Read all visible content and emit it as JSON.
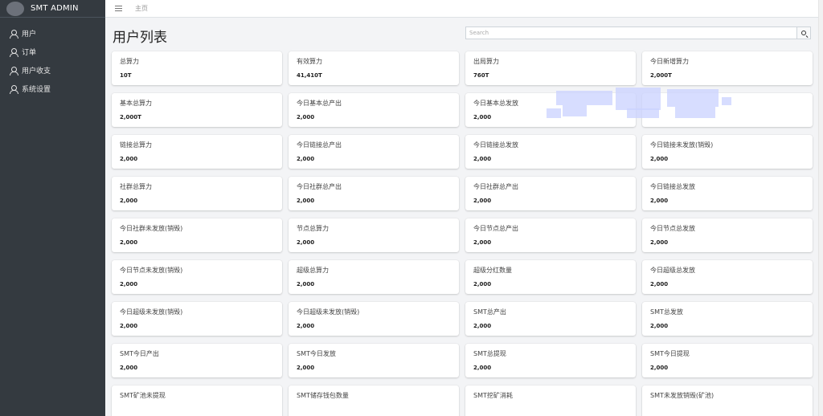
{
  "app": {
    "brand": "SMT ADMIN"
  },
  "sidebar": {
    "items": [
      {
        "label": "用户",
        "icon": "user-icon"
      },
      {
        "label": "订单",
        "icon": "user-icon"
      },
      {
        "label": "用户收支",
        "icon": "user-icon"
      },
      {
        "label": "系统设置",
        "icon": "user-icon"
      }
    ]
  },
  "topbar": {
    "home_label": "主页",
    "menu_icon": "hamburger-icon"
  },
  "page": {
    "title": "用户列表"
  },
  "search": {
    "placeholder": "Search",
    "value": "",
    "button_icon": "search-icon"
  },
  "cards": [
    {
      "label": "总算力",
      "value": "10T"
    },
    {
      "label": "有效算力",
      "value": "41,410T"
    },
    {
      "label": "出局算力",
      "value": "760T"
    },
    {
      "label": "今日新增算力",
      "value": "2,000T"
    },
    {
      "label": "基本总算力",
      "value": "2,000T"
    },
    {
      "label": "今日基本总产出",
      "value": "2,000"
    },
    {
      "label": "今日基本总发放",
      "value": "2,000"
    },
    {
      "label": "",
      "value": ""
    },
    {
      "label": "链接总算力",
      "value": "2,000"
    },
    {
      "label": "今日链接总产出",
      "value": "2,000"
    },
    {
      "label": "今日链接总发放",
      "value": "2,000"
    },
    {
      "label": "今日链接未发放(销毁)",
      "value": "2,000"
    },
    {
      "label": "社群总算力",
      "value": "2,000"
    },
    {
      "label": "今日社群总产出",
      "value": "2,000"
    },
    {
      "label": "今日社群总产出",
      "value": "2,000"
    },
    {
      "label": "今日链接总发放",
      "value": "2,000"
    },
    {
      "label": "今日社群未发放(销毁)",
      "value": "2,000"
    },
    {
      "label": "节点总算力",
      "value": "2,000"
    },
    {
      "label": "今日节点总产出",
      "value": "2,000"
    },
    {
      "label": "今日节点总发放",
      "value": "2,000"
    },
    {
      "label": "今日节点未发放(销毁)",
      "value": "2,000"
    },
    {
      "label": "超级总算力",
      "value": "2,000"
    },
    {
      "label": "超级分红数量",
      "value": "2,000"
    },
    {
      "label": "今日超级总发放",
      "value": "2,000"
    },
    {
      "label": "今日超级未发放(销毁)",
      "value": "2,000"
    },
    {
      "label": "今日超级未发放(销毁)",
      "value": "2,000"
    },
    {
      "label": "SMT总产出",
      "value": "2,000"
    },
    {
      "label": "SMT总发放",
      "value": "2,000"
    },
    {
      "label": "SMT今日产出",
      "value": "2,000"
    },
    {
      "label": "SMT今日发放",
      "value": "2,000"
    },
    {
      "label": "SMT总提现",
      "value": "2,000"
    },
    {
      "label": "SMT今日提现",
      "value": "2,000"
    },
    {
      "label": "SMT矿池未提现",
      "value": ""
    },
    {
      "label": "SMT储存钱包数量",
      "value": ""
    },
    {
      "label": "SMT挖矿消耗",
      "value": ""
    },
    {
      "label": "SMT未发放销毁(矿池)",
      "value": ""
    }
  ]
}
